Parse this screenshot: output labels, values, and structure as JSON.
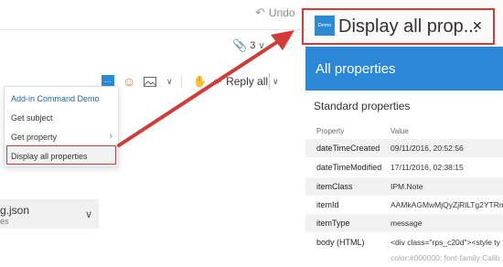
{
  "mail": {
    "undo_label": "Undo",
    "attachment_count": "3",
    "toolbar": {
      "addin_icon_label": "Demo",
      "reply_all_label": "Reply all"
    },
    "menu": {
      "header": "Add-in Command Demo",
      "items": [
        "Get subject",
        "Get property",
        "Display all properties"
      ]
    },
    "attachment": {
      "name": "g.json",
      "sub": "es"
    }
  },
  "pane": {
    "logo_text": "Demo",
    "title": "Display all prop...",
    "banner": "All properties",
    "section_title": "Standard properties",
    "columns": [
      "Property",
      "Value"
    ],
    "rows": [
      {
        "key": "dateTimeCreated",
        "value": "09/11/2016, 20:52:56"
      },
      {
        "key": "dateTimeModified",
        "value": "17/11/2016, 02:38:15"
      },
      {
        "key": "itemClass",
        "value": "IPM.Note"
      },
      {
        "key": "itemId",
        "value": "AAMkAGMwMjQyZjRlLTg2YTRm"
      },
      {
        "key": "itemType",
        "value": "message"
      },
      {
        "key": "body (HTML)",
        "value": "<div class=\"rps_c20d\"><style ty"
      }
    ],
    "row_overflow": "color:#000000; font-family:Calib"
  },
  "colors": {
    "accent": "#2b88d8",
    "highlight": "#d23b37"
  }
}
